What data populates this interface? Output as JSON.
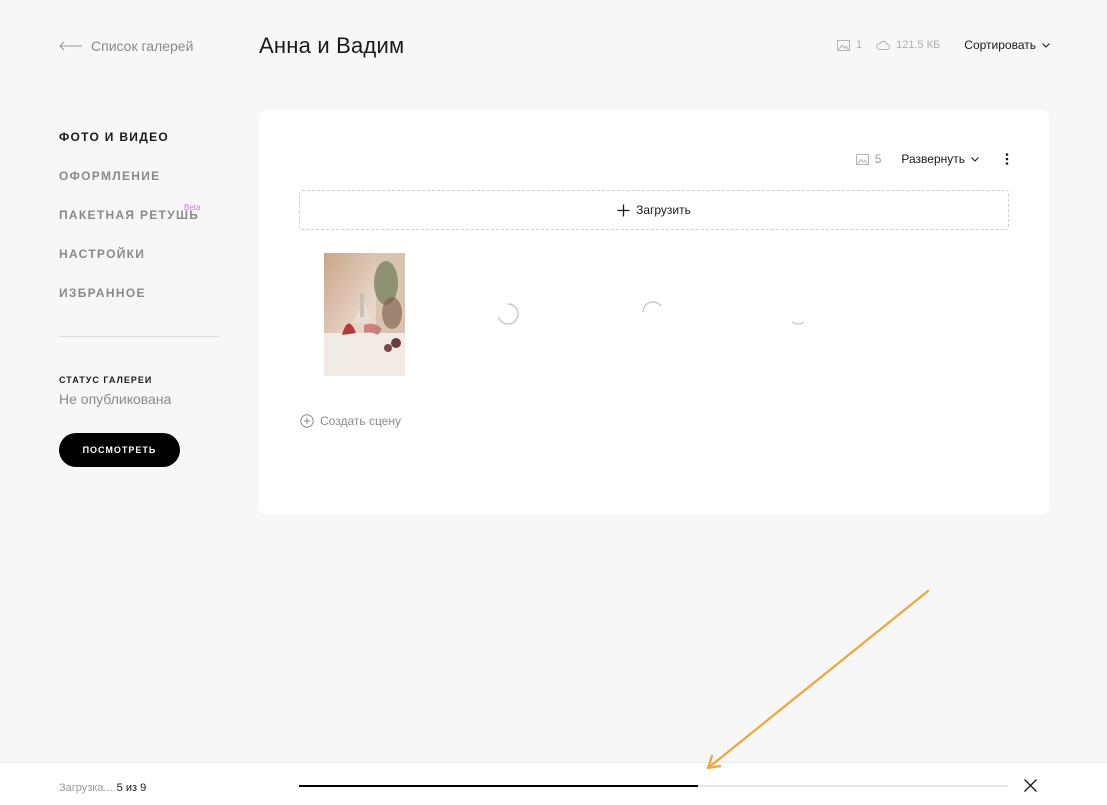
{
  "header": {
    "back_label": "Список галерей",
    "title": "Анна и Вадим",
    "photo_count": "1",
    "storage": "121.5 КБ",
    "sort_label": "Сортировать"
  },
  "sidebar": {
    "items": [
      {
        "label": "ФОТО И ВИДЕО",
        "active": true
      },
      {
        "label": "ОФОРМЛЕНИЕ"
      },
      {
        "label": "ПАКЕТНАЯ РЕТУШЬ",
        "badge": "Beta"
      },
      {
        "label": "НАСТРОЙКИ"
      },
      {
        "label": "ИЗБРАННОЕ"
      }
    ],
    "status_label": "СТАТУС ГАЛЕРЕИ",
    "status_value": "Не опубликована",
    "view_button": "ПОСМОТРЕТЬ"
  },
  "card": {
    "media_count": "5",
    "expand_label": "Развернуть",
    "upload_label": "Загрузить",
    "create_scene_label": "Создать сцену"
  },
  "upload_progress": {
    "label": "Загрузка...",
    "count": "5 из 9",
    "fraction": 0.5625
  },
  "colors": {
    "accent": "#000000",
    "beta": "#c77dd8",
    "annotation": "#f0a43a",
    "background": "#f7f7f7"
  }
}
